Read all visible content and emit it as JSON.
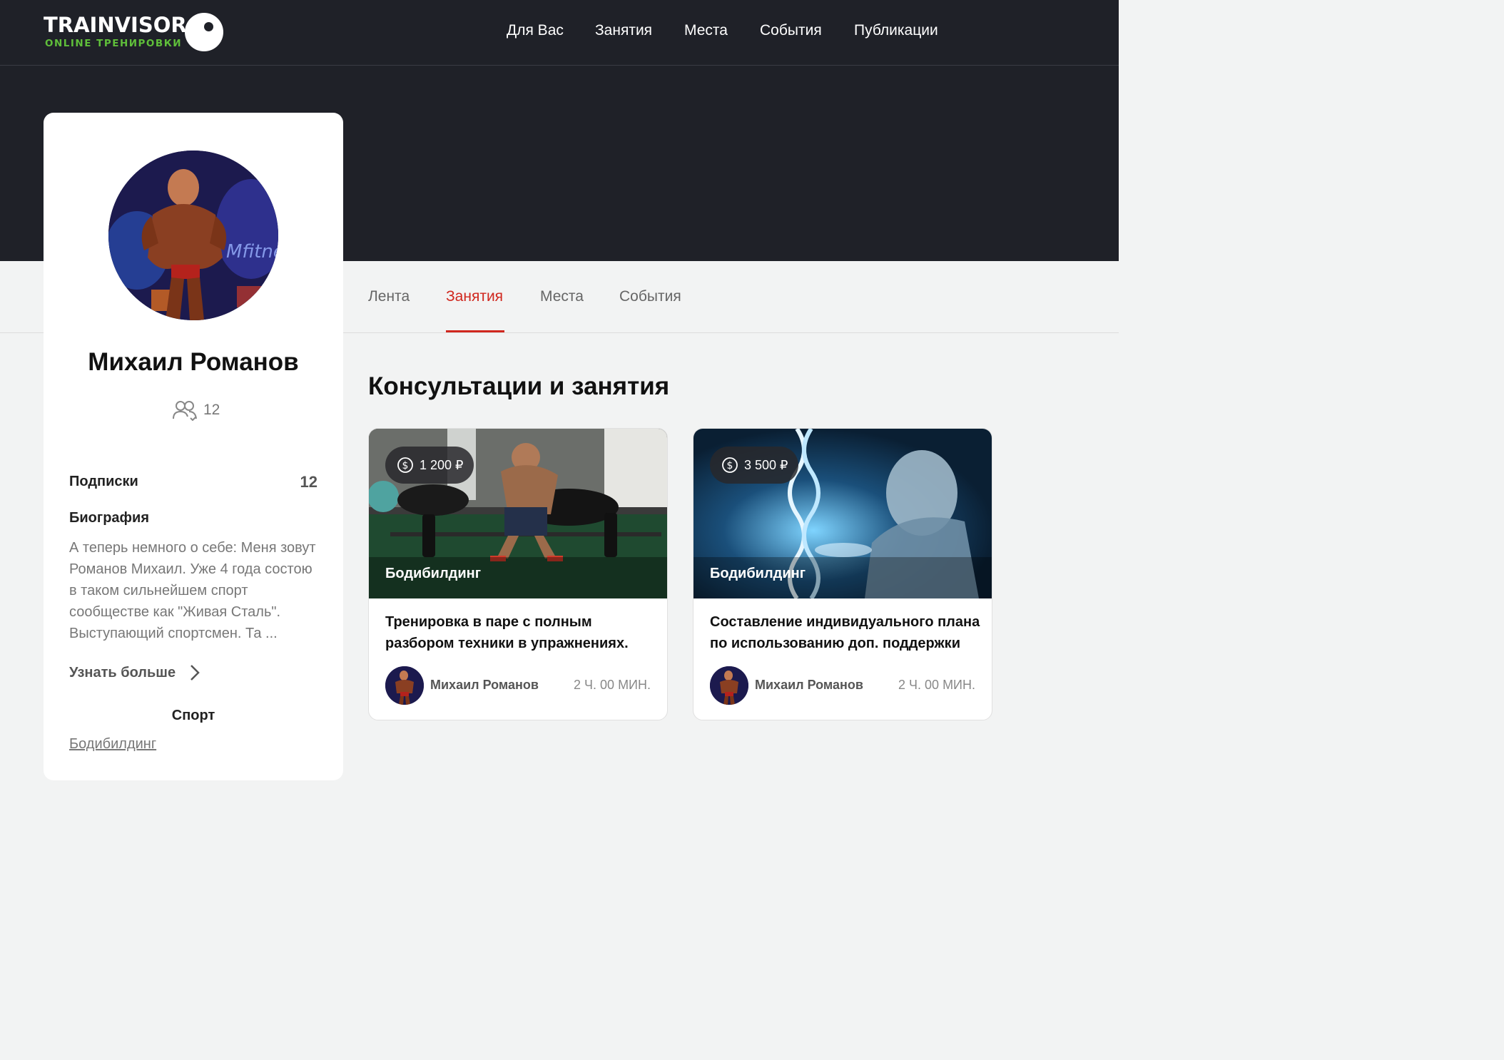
{
  "logo": {
    "word": "TRAINVISOR",
    "sub": "ONLINE ТРЕНИРОВКИ"
  },
  "topnav": [
    "Для Вас",
    "Занятия",
    "Места",
    "События",
    "Публикации"
  ],
  "profile": {
    "name": "Михаил Романов",
    "followers": "12",
    "subs_label": "Подписки",
    "subs_value": "12",
    "bio_label": "Биография",
    "bio": "А теперь немного о себе: Меня зовут Романов Михаил. Уже 4 года состою в таком сильнейшем спорт сообществе как \"Живая Сталь\". Выступающий спортсмен. Та ...",
    "more": "Узнать больше",
    "sport_label": "Спорт",
    "sport": "Бодибилдинг"
  },
  "tabs": [
    "Лента",
    "Занятия",
    "Места",
    "События"
  ],
  "active_tab": "Занятия",
  "section_title": "Консультации и занятия",
  "cards": [
    {
      "price": "1 200 ₽",
      "tag": "Бодибилдинг",
      "title": "Тренировка в паре с полным разбором техники в упражнениях.",
      "author": "Михаил Романов",
      "duration": "2 Ч. 00 МИН."
    },
    {
      "price": "3 500 ₽",
      "tag": "Бодибилдинг",
      "title": "Составление индивидуального плана по использованию доп. поддержки",
      "author": "Михаил Романов",
      "duration": "2 Ч. 00 МИН."
    }
  ],
  "colors": {
    "header_bg": "#1f2128",
    "accent": "#d0271e",
    "logo_green": "#5fbf3a",
    "page_bg": "#f2f3f3"
  }
}
